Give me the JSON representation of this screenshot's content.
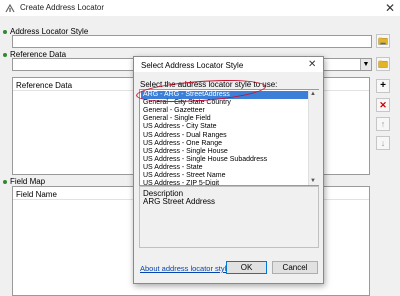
{
  "window": {
    "title": "Create Address Locator",
    "close_glyph": "✕"
  },
  "form": {
    "address_locator_style_label": "Address Locator Style",
    "reference_data_label": "Reference Data",
    "reference_table_column": "Reference Data",
    "field_map_label": "Field Map",
    "field_map_column": "Field Name",
    "required_indicator_color": "#2e8b2e"
  },
  "side_buttons": {
    "add": "+",
    "remove": "✕",
    "up": "↑",
    "down": "↓"
  },
  "dialog": {
    "title": "Select Address Locator Style",
    "close_glyph": "✕",
    "prompt": "Select the address locator style to use:",
    "styles": [
      "ARG - ARG - StreetAddress",
      "General - City State Country",
      "General - Gazetteer",
      "General - Single Field",
      "US Address - City State",
      "US Address - Dual Ranges",
      "US Address - One Range",
      "US Address - Single House",
      "US Address - Single House Subaddress",
      "US Address - State",
      "US Address - Street Name",
      "US Address - ZIP 5-Digit"
    ],
    "selected_index": 0,
    "description_label": "Description",
    "description_value": "ARG Street Address",
    "link": "About address locator styles",
    "ok": "OK",
    "cancel": "Cancel",
    "highlight_color": "#c8102e",
    "selection_color": "#3b7fd9"
  }
}
